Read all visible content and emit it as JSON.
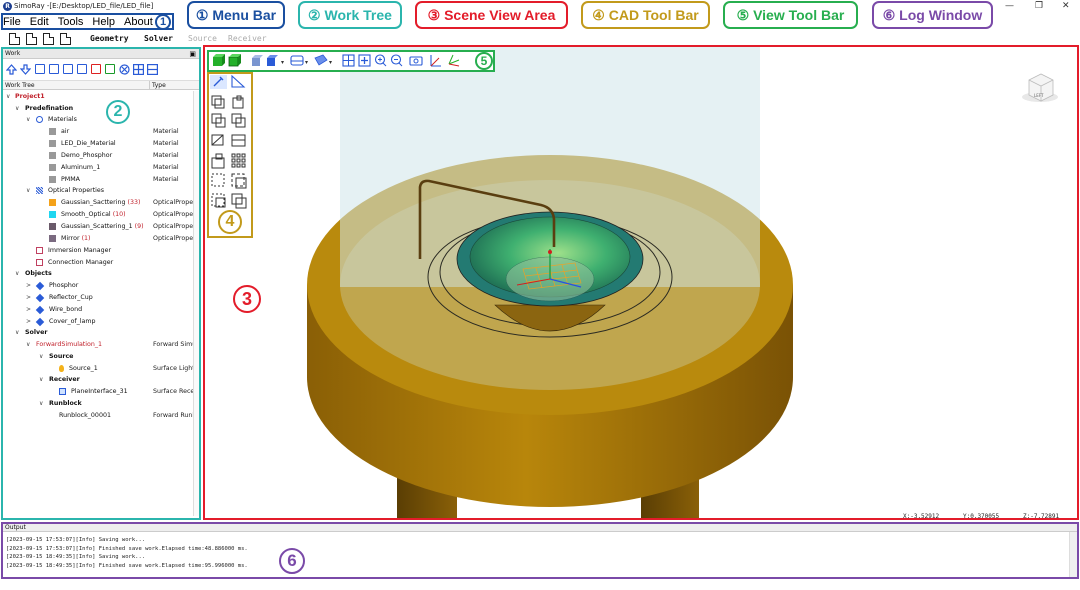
{
  "window": {
    "title": "SimoRay -[E:/Desktop/LED_file/LED_file]",
    "logo": "R",
    "minimize": "—",
    "restore": "❐",
    "close": "✕"
  },
  "menu": [
    "File",
    "Edit",
    "Tools",
    "Help",
    "About"
  ],
  "file_tabs": [
    "Geometry",
    "Solver",
    "Source",
    "Receiver"
  ],
  "annotations": {
    "menu_bar": "① Menu Bar",
    "work_tree": "② Work Tree",
    "scene_view": "③ Scene View Area",
    "cad_tool_bar": "④ CAD Tool Bar",
    "view_tool_bar": "⑤ View Tool Bar",
    "log_window": "⑥ Log Window",
    "marker_1": "1",
    "marker_2": "2",
    "marker_3": "3",
    "marker_4": "4",
    "marker_5": "5",
    "marker_6": "6"
  },
  "colors": {
    "menu_bar": "#1a4fa0",
    "work_tree": "#2bb5ad",
    "scene_view": "#e31c2a",
    "cad_tool_bar": "#c29a1b",
    "view_tool_bar": "#27ae4f",
    "log_window": "#7a4aa8",
    "lamp_gold": "#b8860b",
    "cover_glass": "#cfe6ea"
  },
  "work_panel": {
    "title": "Work",
    "col_tree": "Work Tree",
    "col_type": "Type",
    "rows": [
      {
        "label": "Project1",
        "type": ""
      },
      {
        "label": "Predefination",
        "type": ""
      },
      {
        "label": "Materials",
        "type": ""
      },
      {
        "label": "air",
        "type": "Material"
      },
      {
        "label": "LED_Die_Material",
        "type": "Material"
      },
      {
        "label": "Demo_Phosphor",
        "type": "Material"
      },
      {
        "label": "Aluminum_1",
        "type": "Material"
      },
      {
        "label": "PMMA",
        "type": "Material"
      },
      {
        "label": "Optical Properties",
        "type": ""
      },
      {
        "label": "Gaussian_Sacttering",
        "count": "(33)",
        "type": "OpticalProperty"
      },
      {
        "label": "Smooth_Optical",
        "count": "(10)",
        "type": "OpticalProperty"
      },
      {
        "label": "Gaussian_Scattering_1",
        "count": "(9)",
        "type": "OpticalProperty"
      },
      {
        "label": "Mirror",
        "count": "(1)",
        "type": "OpticalProperty"
      },
      {
        "label": "Immersion Manager",
        "type": ""
      },
      {
        "label": "Connection Manager",
        "type": ""
      },
      {
        "label": "Objects",
        "type": ""
      },
      {
        "label": "Phosphor",
        "type": ""
      },
      {
        "label": "Reflector_Cup",
        "type": ""
      },
      {
        "label": "Wire_bond",
        "type": ""
      },
      {
        "label": "Cover_of_lamp",
        "type": ""
      },
      {
        "label": "Solver",
        "type": ""
      },
      {
        "label": "ForwardSimulation_1",
        "type": "Forward Simulation"
      },
      {
        "label": "Source",
        "type": ""
      },
      {
        "label": "Source_1",
        "type": "Surface Light Source"
      },
      {
        "label": "Receiver",
        "type": ""
      },
      {
        "label": "PlaneInterface_31",
        "type": "Surface Receiver"
      },
      {
        "label": "Runblock",
        "type": ""
      },
      {
        "label": "Runblock_00001",
        "type": "Forward Runblock"
      }
    ]
  },
  "scene": {
    "coord_x": "X:-3.52912",
    "coord_y": "Y:0.370055",
    "coord_z": "Z:-7.72891",
    "nav_cube": "LEFT"
  },
  "log": {
    "title": "Output",
    "lines": [
      "[2023-09-15 17:53:07][Info] Saving work...",
      "[2023-09-15 17:53:07][Info] Finished save work.Elapsed time:48.886000 ms.",
      "[2023-09-15 18:49:35][Info] Saving work...",
      "[2023-09-15 18:49:35][Info] Finished save work.Elapsed time:95.996000 ms."
    ]
  }
}
